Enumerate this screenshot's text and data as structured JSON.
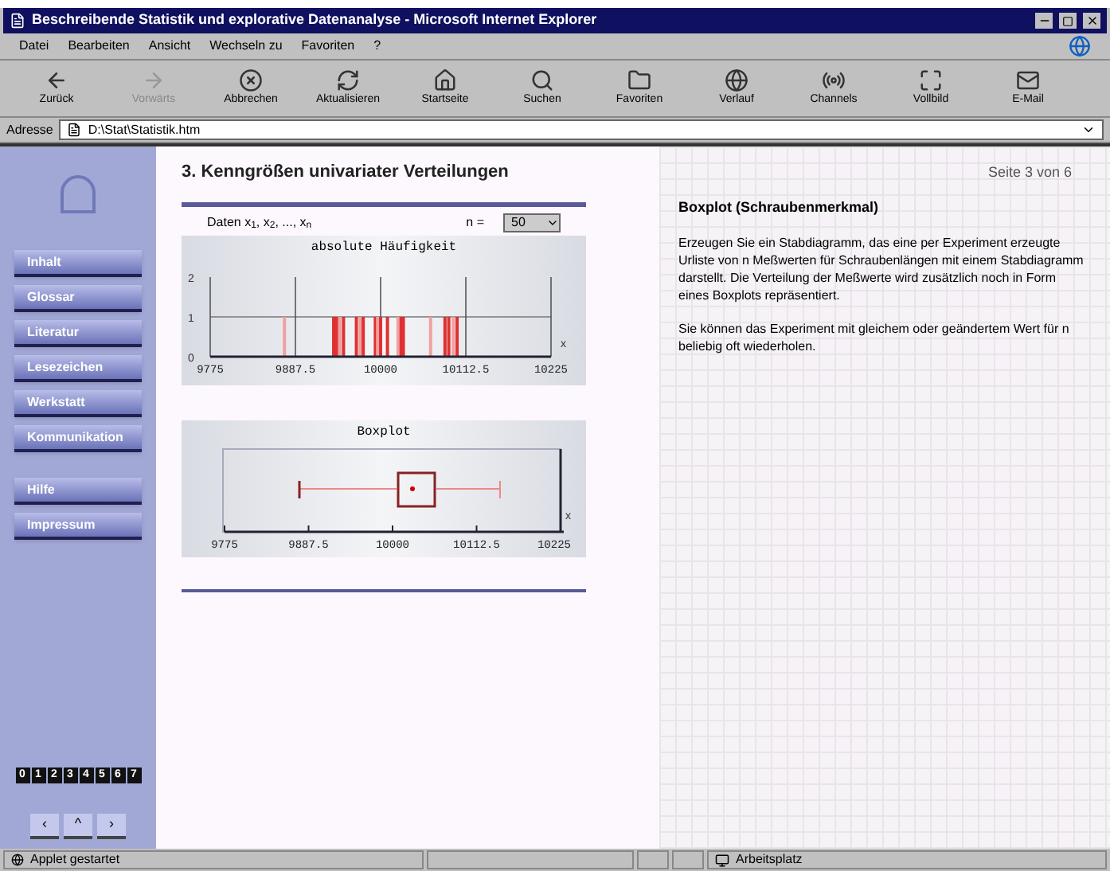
{
  "window": {
    "title": "Beschreibende Statistik und explorative Datenanalyse - Microsoft Internet Explorer"
  },
  "menu": [
    "Datei",
    "Bearbeiten",
    "Ansicht",
    "Wechseln zu",
    "Favoriten",
    "?"
  ],
  "toolbar": [
    {
      "label": "Zurück",
      "kind": "back",
      "disabled": false
    },
    {
      "label": "Vorwärts",
      "kind": "forward",
      "disabled": true
    },
    {
      "label": "Abbrechen",
      "kind": "stop",
      "disabled": false
    },
    {
      "label": "Aktualisieren",
      "kind": "refresh",
      "disabled": false
    },
    {
      "label": "Startseite",
      "kind": "home",
      "disabled": false
    },
    {
      "label": "Suchen",
      "kind": "search",
      "disabled": false
    },
    {
      "label": "Favoriten",
      "kind": "favorites",
      "disabled": false
    },
    {
      "label": "Verlauf",
      "kind": "history",
      "disabled": false
    },
    {
      "label": "Channels",
      "kind": "channels",
      "disabled": false
    },
    {
      "label": "Vollbild",
      "kind": "fullscreen",
      "disabled": false
    },
    {
      "label": "E-Mail",
      "kind": "mail",
      "disabled": false
    }
  ],
  "address": {
    "label": "Adresse",
    "value": "D:\\Stat\\Statistik.htm"
  },
  "sidebar": {
    "items": [
      "Inhalt",
      "Glossar",
      "Literatur",
      "Lesezeichen",
      "Werkstatt",
      "Kommunikation"
    ],
    "items_2": [
      "Hilfe",
      "Impressum"
    ],
    "pages": [
      "0",
      "1",
      "2",
      "3",
      "4",
      "5",
      "6",
      "7"
    ],
    "nav": [
      "‹",
      "^",
      "›"
    ]
  },
  "main": {
    "heading": "3. Kenngrößen univariater Verteilungen",
    "data_label": "Daten x$_{1}$, x$_{2}$, ..., x$_{n}$",
    "n_label": "n =",
    "n_value": "50",
    "stick_chart": {
      "chart_data": {
        "type": "bar",
        "title": "absolute Häufigkeit",
        "xlabel": "x",
        "x": [
          9873,
          9938,
          9942,
          9946,
          9951,
          9968,
          9973,
          9977,
          9993,
          9996,
          10000,
          10009,
          10023,
          10027,
          10030,
          10066,
          10085,
          10090,
          10096,
          10101
        ],
        "values": [
          1,
          1,
          1,
          1,
          1,
          1,
          1,
          1,
          1,
          1,
          1,
          1,
          1,
          1,
          1,
          1,
          1,
          1,
          1,
          1
        ],
        "xlim": [
          9775,
          10225
        ],
        "ylim": [
          0,
          2
        ],
        "grid": true,
        "ref_lines": [
          {
            "axis": "y",
            "value": 1
          }
        ],
        "xticks": [
          9775,
          9887.5,
          10000,
          10112.5,
          10225
        ],
        "yticks": [
          0,
          1,
          2
        ]
      }
    },
    "boxplot": {
      "title": "Boxplot",
      "xlabel": "x",
      "ticks": [
        "9775",
        "9887.5",
        "10000",
        "10112.5",
        "10225"
      ]
    }
  },
  "info": {
    "page": "Seite 3 von 6",
    "title": "Boxplot (Schraubenmerkmal)",
    "paragraphs": [
      "Erzeugen Sie ein Stabdiagramm, das eine per Experiment erzeugte Urliste von n Meßwerten für Schraubenlängen mit einem Stabdiagramm darstellt. Die Verteilung der Meßwerte wird zusätzlich noch in Form eines Boxplots repräsentiert.",
      "Sie können das Experiment mit gleichem oder geändertem Wert für n beliebig oft wiederholen."
    ]
  },
  "status_bar": {
    "text": "Applet gestartet",
    "zone": "Arbeitsplatz"
  }
}
